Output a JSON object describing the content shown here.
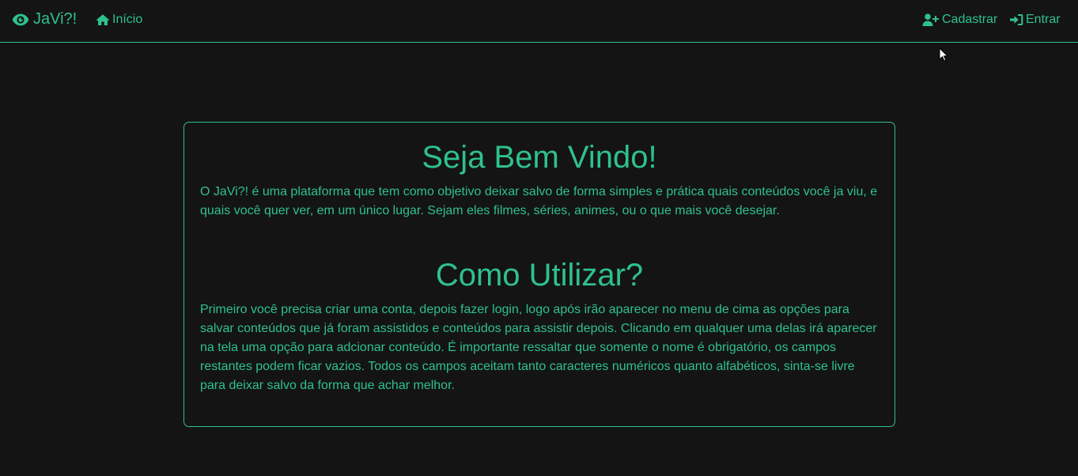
{
  "navbar": {
    "brand": "JaVi?!",
    "home_label": "Início",
    "signup_label": "Cadastrar",
    "login_label": "Entrar"
  },
  "welcome": {
    "title": "Seja Bem Vindo!",
    "text": "O JaVi?! é uma plataforma que tem como objetivo deixar salvo de forma simples e prática quais conteúdos você ja viu, e quais você quer ver, em um único lugar. Sejam eles filmes, séries, animes, ou o que mais você desejar."
  },
  "howto": {
    "title": "Como Utilizar?",
    "text": "Primeiro você precisa criar uma conta, depois fazer login, logo após irão aparecer no menu de cima as opções para salvar conteúdos que já foram assistidos e conteúdos para assistir depois. Clicando em qualquer uma delas irá aparecer na tela uma opção para adcionar conteúdo. É importante ressaltar que somente o nome é obrigatório, os campos restantes podem ficar vazios. Todos os campos aceitam tanto caracteres numéricos quanto alfabéticos, sinta-se livre para deixar salvo da forma que achar melhor."
  },
  "icons": {
    "brand": "eye-icon",
    "home": "home-icon",
    "signup": "user-plus-icon",
    "login": "sign-in-icon"
  },
  "colors": {
    "accent": "#2fc18c",
    "background": "#141414"
  }
}
